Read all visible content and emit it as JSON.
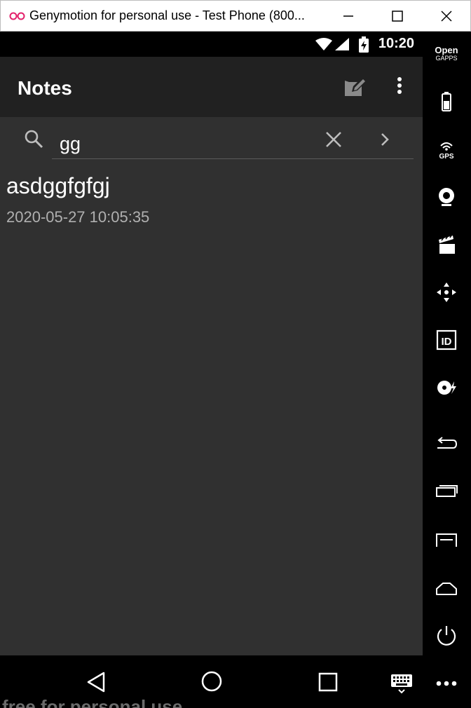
{
  "window": {
    "title": "Genymotion for personal use - Test Phone (800...",
    "logo_icon": "genymotion-logo-icon",
    "minimize_icon": "minimize-icon",
    "maximize_icon": "maximize-icon",
    "close_icon": "close-icon"
  },
  "status_bar": {
    "time": "10:20",
    "icons": [
      "wifi-icon",
      "signal-icon",
      "battery-charging-icon"
    ]
  },
  "app_bar": {
    "title": "Notes",
    "actions": [
      "new-note-icon",
      "overflow-menu-icon"
    ]
  },
  "search": {
    "query": "gg",
    "icons": [
      "search-icon",
      "clear-icon",
      "chevron-right-icon"
    ]
  },
  "notes": [
    {
      "title": "asdggfgfgj",
      "date": "2020-05-27 10:05:35"
    }
  ],
  "nav_bar": {
    "buttons": [
      "back-icon",
      "home-icon",
      "recents-icon",
      "keyboard-icon"
    ],
    "watermark": "free for personal use"
  },
  "side_toolbar": {
    "open_gapps_line1": "Open",
    "open_gapps_line2": "GAPPS",
    "gps_label": "GPS",
    "id_label": "ID",
    "tools": [
      "open-gapps-icon",
      "battery-icon",
      "gps-icon",
      "webcam-icon",
      "media-icon",
      "dpad-icon",
      "device-id-icon",
      "disk-io-icon",
      "back-icon",
      "recent-apps-icon",
      "menu-icon",
      "home-icon",
      "power-icon",
      "more-icon"
    ]
  },
  "colors": {
    "app_bar": "#212121",
    "content_bg": "#303030",
    "date_text": "#b0b0b0",
    "logo_pink": "#e3216b"
  }
}
